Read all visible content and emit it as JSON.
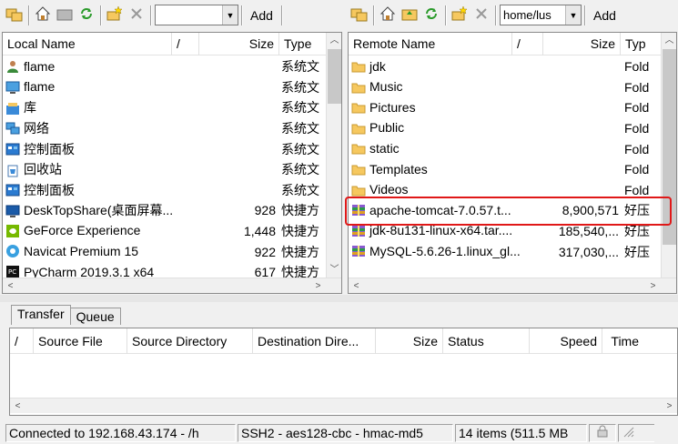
{
  "toolbar": {
    "left_path": "",
    "left_add": "Add",
    "right_path": "home/lus",
    "right_add": "Add"
  },
  "local": {
    "columns": {
      "name": "Local Name",
      "slash": "/",
      "size": "Size",
      "type": "Type"
    },
    "rows": [
      {
        "name": "flame",
        "size": "",
        "type": "系统文",
        "icon": "user-folder-icon"
      },
      {
        "name": "flame",
        "size": "",
        "type": "系统文",
        "icon": "computer-icon"
      },
      {
        "name": "库",
        "size": "",
        "type": "系统文",
        "icon": "library-icon"
      },
      {
        "name": "网络",
        "size": "",
        "type": "系统文",
        "icon": "network-icon"
      },
      {
        "name": "控制面板",
        "size": "",
        "type": "系统文",
        "icon": "control-panel-icon"
      },
      {
        "name": "回收站",
        "size": "",
        "type": "系统文",
        "icon": "recycle-bin-icon"
      },
      {
        "name": "控制面板",
        "size": "",
        "type": "系统文",
        "icon": "control-panel-icon"
      },
      {
        "name": "DeskTopShare(桌面屏幕...",
        "size": "928",
        "type": "快捷方",
        "icon": "desktop-share-icon"
      },
      {
        "name": "GeForce Experience",
        "size": "1,448",
        "type": "快捷方",
        "icon": "geforce-icon"
      },
      {
        "name": "Navicat Premium 15",
        "size": "922",
        "type": "快捷方",
        "icon": "navicat-icon"
      },
      {
        "name": "PyCharm 2019.3.1 x64",
        "size": "617",
        "type": "快捷方",
        "icon": "pycharm-icon"
      }
    ]
  },
  "remote": {
    "columns": {
      "name": "Remote Name",
      "slash": "/",
      "size": "Size",
      "type": "Typ"
    },
    "rows": [
      {
        "name": "jdk",
        "size": "",
        "type": "Fold",
        "icon": "folder-icon"
      },
      {
        "name": "Music",
        "size": "",
        "type": "Fold",
        "icon": "folder-icon"
      },
      {
        "name": "Pictures",
        "size": "",
        "type": "Fold",
        "icon": "folder-icon"
      },
      {
        "name": "Public",
        "size": "",
        "type": "Fold",
        "icon": "folder-icon"
      },
      {
        "name": "static",
        "size": "",
        "type": "Fold",
        "icon": "folder-icon"
      },
      {
        "name": "Templates",
        "size": "",
        "type": "Fold",
        "icon": "folder-icon"
      },
      {
        "name": "Videos",
        "size": "",
        "type": "Fold",
        "icon": "folder-icon"
      },
      {
        "name": "apache-tomcat-7.0.57.t...",
        "size": "8,900,571",
        "type": "好压",
        "icon": "archive-icon"
      },
      {
        "name": "jdk-8u131-linux-x64.tar....",
        "size": "185,540,...",
        "type": "好压",
        "icon": "archive-icon"
      },
      {
        "name": "MySQL-5.6.26-1.linux_gl...",
        "size": "317,030,...",
        "type": "好压",
        "icon": "archive-icon"
      }
    ]
  },
  "transfer": {
    "tabs": [
      "Transfer",
      "Queue"
    ],
    "columns": {
      "slash": "/",
      "source_file": "Source File",
      "source_dir": "Source Directory",
      "dest_dir": "Destination Dire...",
      "size": "Size",
      "status": "Status",
      "speed": "Speed",
      "time": "Time"
    }
  },
  "status": {
    "connection": "Connected to 192.168.43.174 - /h",
    "cipher": "SSH2 - aes128-cbc - hmac-md5",
    "items": "14 items (511.5 MB"
  },
  "colors": {
    "highlight": "#e01818",
    "folder": "#f6c85f"
  }
}
